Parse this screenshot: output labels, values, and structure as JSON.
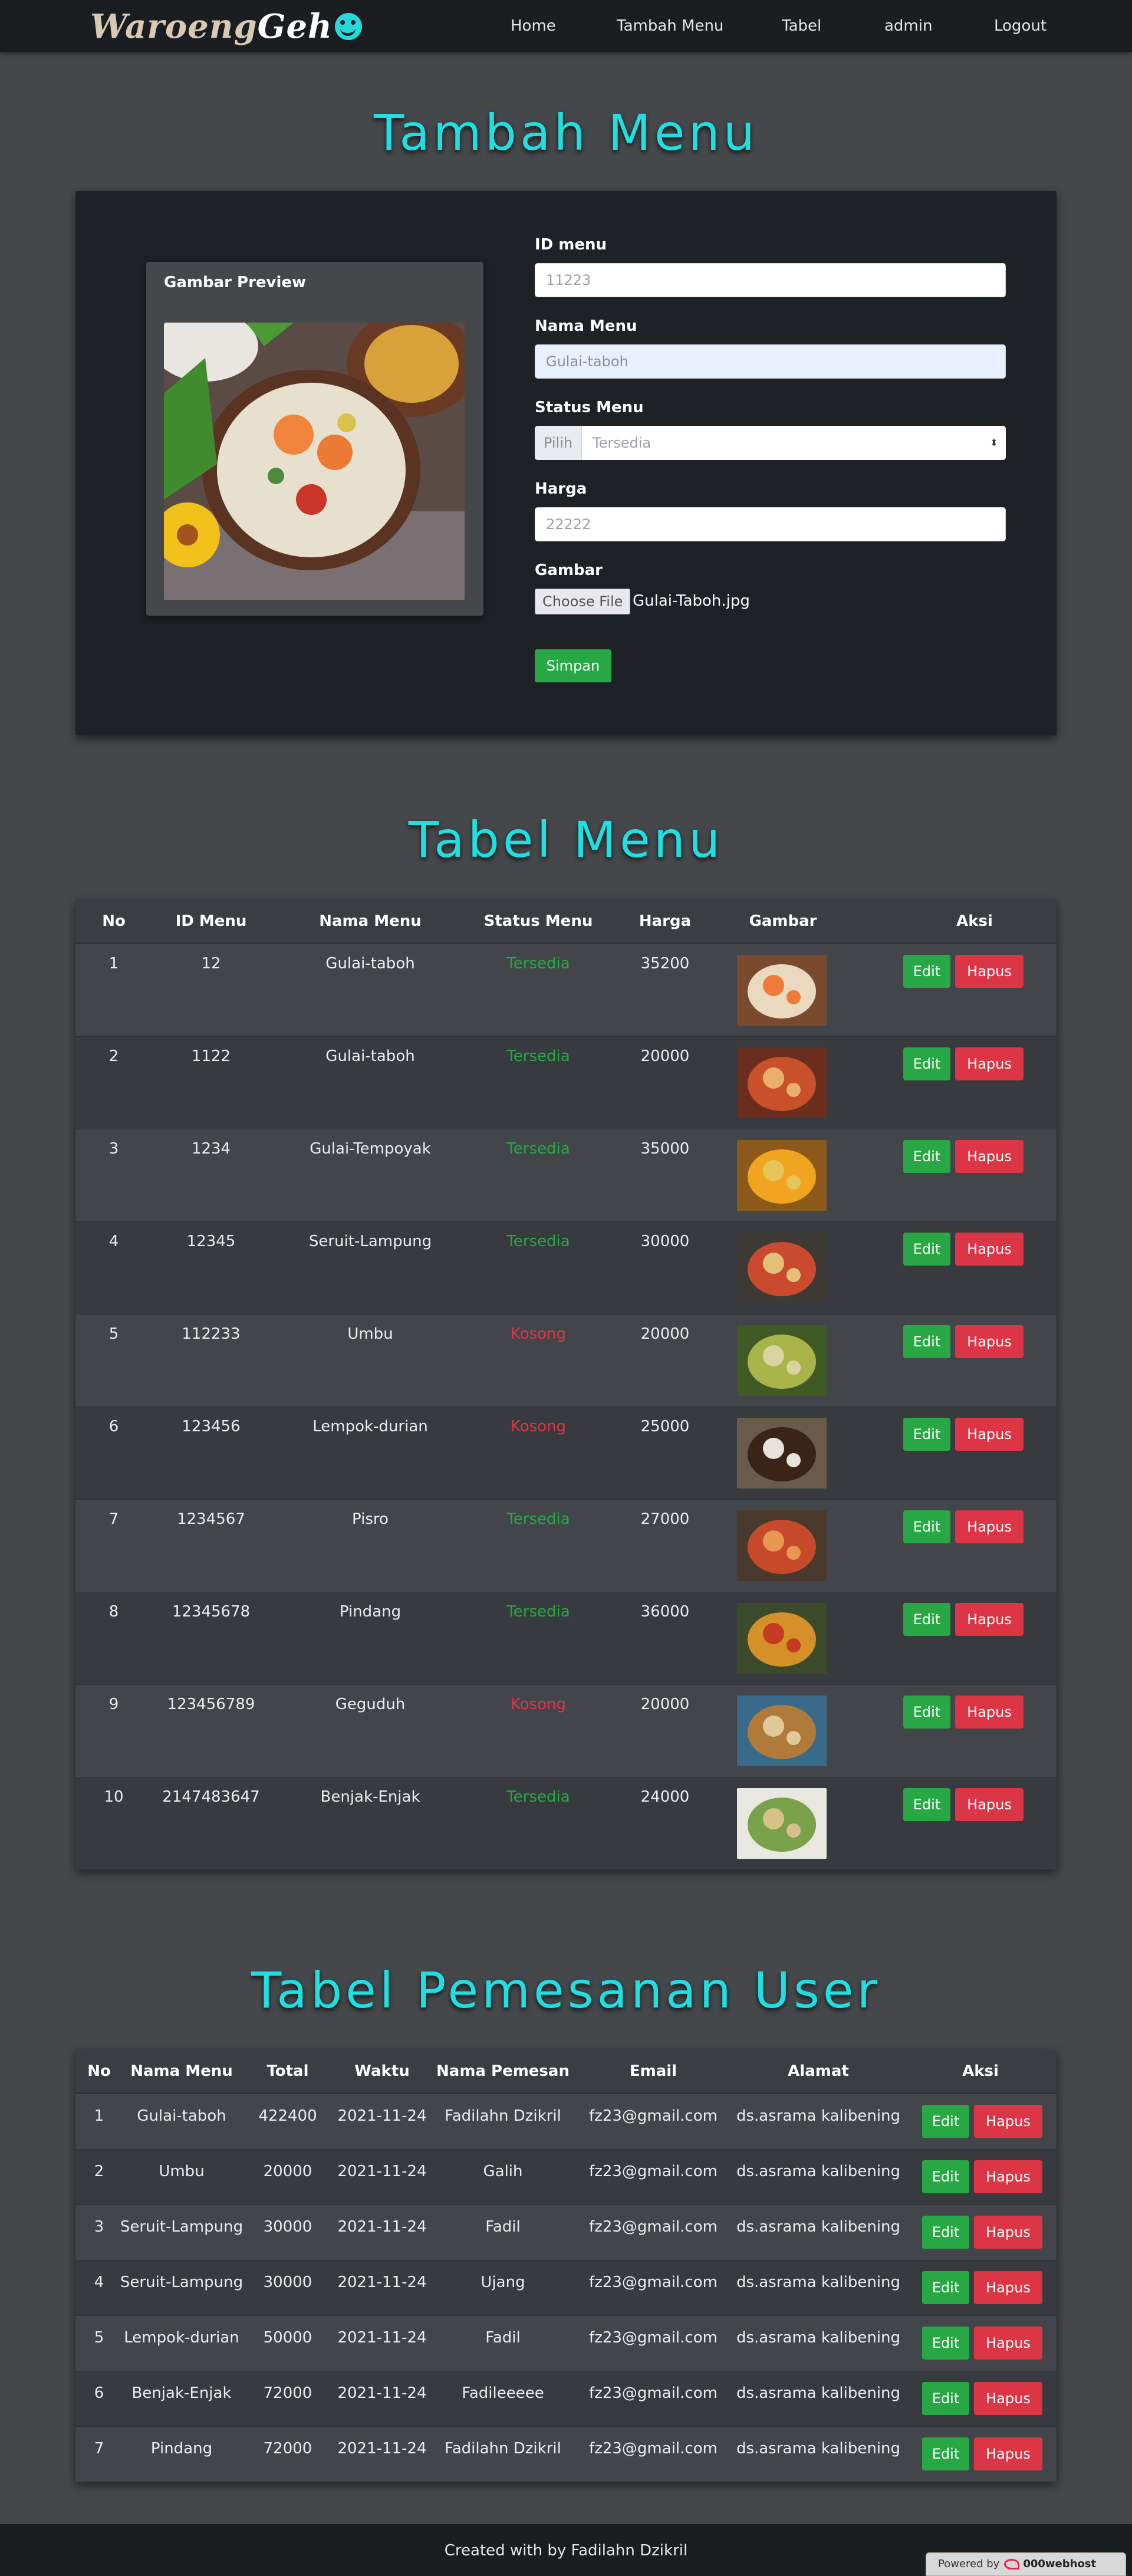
{
  "navbar": {
    "brand_word": "Waroeng",
    "brand_accent": "Geh",
    "links": [
      "Home",
      "Tambah Menu",
      "Tabel",
      "admin",
      "Logout"
    ]
  },
  "form_section": {
    "title": "Tambah Menu",
    "preview_title": "Gambar Preview",
    "id_label": "ID menu",
    "id_placeholder": "11223",
    "name_label": "Nama Menu",
    "name_value": "Gulai-taboh",
    "status_label": "Status Menu",
    "status_prefix": "Pilih",
    "status_value": "Tersedia",
    "price_label": "Harga",
    "price_placeholder": "22222",
    "image_label": "Gambar",
    "file_button": "Choose File",
    "file_name": "Gulai-Taboh.jpg",
    "save_label": "Simpan"
  },
  "menu_section": {
    "title": "Tabel Menu",
    "headers": [
      "No",
      "ID Menu",
      "Nama Menu",
      "Status Menu",
      "Harga",
      "Gambar",
      "Aksi"
    ],
    "edit_label": "Edit",
    "delete_label": "Hapus",
    "rows": [
      {
        "no": "1",
        "id": "12",
        "name": "Gulai-taboh",
        "status": "Tersedia",
        "available": true,
        "price": "35200"
      },
      {
        "no": "2",
        "id": "1122",
        "name": "Gulai-taboh",
        "status": "Tersedia",
        "available": true,
        "price": "20000"
      },
      {
        "no": "3",
        "id": "1234",
        "name": "Gulai-Tempoyak",
        "status": "Tersedia",
        "available": true,
        "price": "35000"
      },
      {
        "no": "4",
        "id": "12345",
        "name": "Seruit-Lampung",
        "status": "Tersedia",
        "available": true,
        "price": "30000"
      },
      {
        "no": "5",
        "id": "112233",
        "name": "Umbu",
        "status": "Kosong",
        "available": false,
        "price": "20000"
      },
      {
        "no": "6",
        "id": "123456",
        "name": "Lempok-durian",
        "status": "Kosong",
        "available": false,
        "price": "25000"
      },
      {
        "no": "7",
        "id": "1234567",
        "name": "Pisro",
        "status": "Tersedia",
        "available": true,
        "price": "27000"
      },
      {
        "no": "8",
        "id": "12345678",
        "name": "Pindang",
        "status": "Tersedia",
        "available": true,
        "price": "36000"
      },
      {
        "no": "9",
        "id": "123456789",
        "name": "Geguduh",
        "status": "Kosong",
        "available": false,
        "price": "20000"
      },
      {
        "no": "10",
        "id": "2147483647",
        "name": "Benjak-Enjak",
        "status": "Tersedia",
        "available": true,
        "price": "24000"
      }
    ]
  },
  "order_section": {
    "title": "Tabel Pemesanan User",
    "headers": [
      "No",
      "Nama Menu",
      "Total",
      "Waktu",
      "Nama Pemesan",
      "Email",
      "Alamat",
      "Aksi"
    ],
    "edit_label": "Edit",
    "delete_label": "Hapus",
    "rows": [
      {
        "no": "1",
        "menu": "Gulai-taboh",
        "total": "422400",
        "time": "2021-11-24",
        "customer": "Fadilahn Dzikril",
        "email": "fz23@gmail.com",
        "address": "ds.asrama kalibening"
      },
      {
        "no": "2",
        "menu": "Umbu",
        "total": "20000",
        "time": "2021-11-24",
        "customer": "Galih",
        "email": "fz23@gmail.com",
        "address": "ds.asrama kalibening"
      },
      {
        "no": "3",
        "menu": "Seruit-Lampung",
        "total": "30000",
        "time": "2021-11-24",
        "customer": "Fadil",
        "email": "fz23@gmail.com",
        "address": "ds.asrama kalibening"
      },
      {
        "no": "4",
        "menu": "Seruit-Lampung",
        "total": "30000",
        "time": "2021-11-24",
        "customer": "Ujang",
        "email": "fz23@gmail.com",
        "address": "ds.asrama kalibening"
      },
      {
        "no": "5",
        "menu": "Lempok-durian",
        "total": "50000",
        "time": "2021-11-24",
        "customer": "Fadil",
        "email": "fz23@gmail.com",
        "address": "ds.asrama kalibening"
      },
      {
        "no": "6",
        "menu": "Benjak-Enjak",
        "total": "72000",
        "time": "2021-11-24",
        "customer": "Fadileeeee",
        "email": "fz23@gmail.com",
        "address": "ds.asrama kalibening"
      },
      {
        "no": "7",
        "menu": "Pindang",
        "total": "72000",
        "time": "2021-11-24",
        "customer": "Fadilahn Dzikril",
        "email": "fz23@gmail.com",
        "address": "ds.asrama kalibening"
      }
    ]
  },
  "footer": {
    "text": "Created with by Fadilahn Dzikril",
    "powered_prefix": "Powered by",
    "powered_brand": "000webhost"
  },
  "colors": {
    "accent": "#1fdfe2",
    "success": "#28a745",
    "danger": "#dc3545",
    "navbar": "#1b1e21",
    "page": "#45484a"
  }
}
